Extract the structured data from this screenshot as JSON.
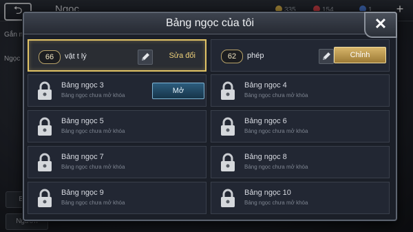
{
  "background": {
    "screen_title": "Ngọc",
    "resources": [
      {
        "value": "335",
        "color": "#d9b24a"
      },
      {
        "value": "154",
        "color": "#d8434a"
      },
      {
        "value": "1",
        "color": "#4a7bd8"
      }
    ],
    "left_tabs": [
      "Gắn n",
      "Ngọc"
    ],
    "left_buttons": [
      "Bảng",
      "Ngươn"
    ]
  },
  "dialog": {
    "title": "Bảng ngọc của tôi",
    "close_label": "✕",
    "active_slots": [
      {
        "points": "66",
        "name": "vật t lý",
        "action": "Sửa đổi"
      },
      {
        "points": "62",
        "name": "phép",
        "action": "Chỉnh"
      }
    ],
    "locked_slots": [
      {
        "title": "Bảng ngọc 3",
        "subtitle": "Bảng ngọc chưa mở khóa",
        "action": "Mở"
      },
      {
        "title": "Bảng ngọc 4",
        "subtitle": "Bảng ngọc chưa mở khóa"
      },
      {
        "title": "Bảng ngọc 5",
        "subtitle": "Bảng ngọc chưa mở khóa"
      },
      {
        "title": "Bảng ngọc 6",
        "subtitle": "Bảng ngọc chưa mở khóa"
      },
      {
        "title": "Bảng ngọc 7",
        "subtitle": "Bảng ngọc chưa mở khóa"
      },
      {
        "title": "Bảng ngọc 8",
        "subtitle": "Bảng ngọc chưa mở khóa"
      },
      {
        "title": "Bảng ngọc 9",
        "subtitle": "Bảng ngọc chưa mở khóa"
      },
      {
        "title": "Bảng ngọc 10",
        "subtitle": "Bảng ngọc chưa mở khóa"
      }
    ]
  },
  "colors": {
    "gold_accent": "#e2c466",
    "blue_button": "#2c5c7d"
  }
}
